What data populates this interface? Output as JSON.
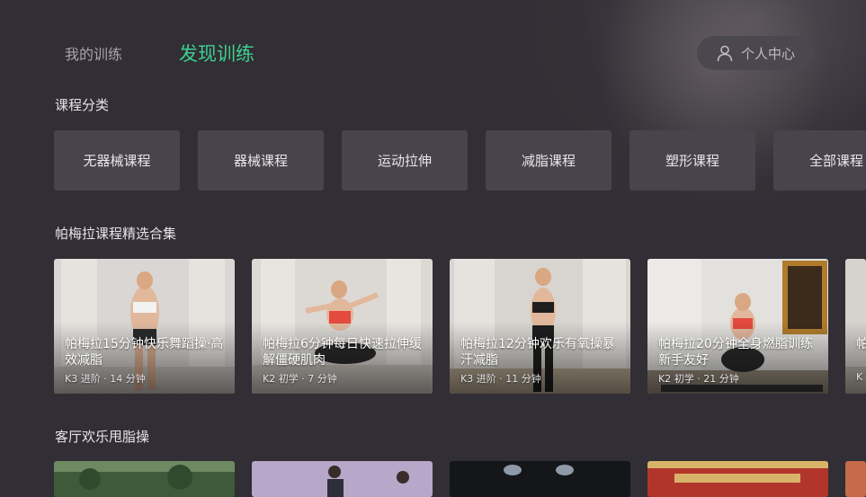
{
  "nav": {
    "tabs": [
      {
        "label": "我的训练",
        "active": false
      },
      {
        "label": "发现训练",
        "active": true
      }
    ],
    "profile_label": "个人中心",
    "accent_color": "#3fcf8e"
  },
  "categories": {
    "title": "课程分类",
    "items": [
      "无器械课程",
      "器械课程",
      "运动拉伸",
      "减脂课程",
      "塑形课程",
      "全部课程"
    ]
  },
  "collection": {
    "title": "帕梅拉课程精选合集",
    "cards": [
      {
        "title": "帕梅拉15分钟快乐舞蹈操·高效减脂",
        "meta": "K3 进阶 · 14 分钟"
      },
      {
        "title": "帕梅拉6分钟每日快速拉伸缓解僵硬肌肉",
        "meta": "K2 初学 · 7 分钟"
      },
      {
        "title": "帕梅拉12分钟欢乐有氧操暴汗减脂",
        "meta": "K3 进阶 · 11 分钟"
      },
      {
        "title": "帕梅拉20分钟全身燃脂训练 新手友好",
        "meta": "K2 初学 · 21 分钟"
      },
      {
        "title": "帕",
        "meta": "K"
      }
    ]
  },
  "living_room": {
    "title": "客厅欢乐甩脂操"
  }
}
